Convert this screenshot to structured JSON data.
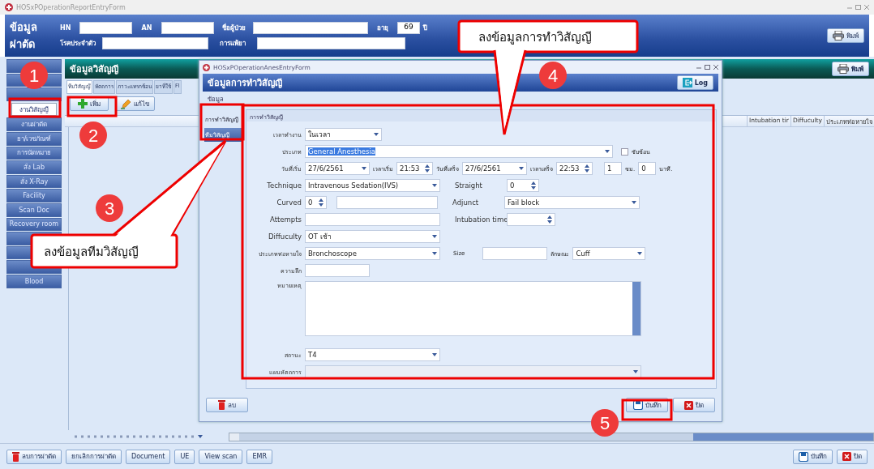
{
  "window": {
    "title": "HOSxPOperationReportEntryForm"
  },
  "patient_header": {
    "title": "ข้อมูลผ่าตัด",
    "fields": [
      {
        "label": "HN"
      },
      {
        "label": "AN"
      },
      {
        "label": "ชื่อผู้ป่วย"
      },
      {
        "label": "อายุ",
        "value": "69",
        "unit": "ปี"
      },
      {
        "label": "โรคประจำตัว"
      },
      {
        "label": "การแพ้ยา"
      }
    ],
    "print_button": {
      "label": "พิมพ์",
      "kind": "print"
    }
  },
  "sidebar": {
    "items": [
      {
        "selected": false
      },
      {
        "selected": false
      },
      {
        "selected": false
      },
      {
        "label": "งานวิสัญญี",
        "selected": true
      },
      {
        "label": "งานผ่าตัด",
        "selected": false
      },
      {
        "label": "ยา/เวชภัณฑ์",
        "selected": false
      },
      {
        "label": "การนัดหมาย",
        "selected": false
      },
      {
        "label": "สั่ง Lab",
        "selected": false
      },
      {
        "label": "สั่ง X-Ray",
        "selected": false
      },
      {
        "label": "Facility",
        "selected": false
      },
      {
        "label": "Scan Doc",
        "selected": false
      },
      {
        "label": "Recovery room",
        "selected": false
      },
      {
        "selected": false
      },
      {
        "selected": false
      },
      {
        "selected": false
      },
      {
        "label": "Blood",
        "selected": false
      }
    ]
  },
  "anes_panel": {
    "title": "ข้อมูลวิสัญญี",
    "print_button": {
      "label": "พิมพ์",
      "kind": "print"
    },
    "tabs": [
      {
        "label": "ทีมวิสัญญี",
        "selected": true
      },
      {
        "label": "หัตถการ",
        "selected": false
      },
      {
        "label": "ภาวะแทรกซ้อน",
        "selected": false
      },
      {
        "label": "ยาที่ใช้",
        "selected": false
      },
      {
        "label": "Fl",
        "selected": false
      }
    ],
    "toolbar": [
      {
        "label": "เพิ่ม",
        "kind": "add"
      },
      {
        "label": "แก้ไข",
        "kind": "edit"
      }
    ],
    "columns": [
      "Intubation tir",
      "Diffuculty",
      "ประเภทท่อหายใจ"
    ]
  },
  "dialog": {
    "title": "HOSxPOperationAnesEntryForm",
    "header": "ข้อมูลการทำวิสัญญี",
    "log_button": {
      "label": "Log",
      "kind": "log"
    },
    "menu": "ข้อมูล",
    "nav": [
      {
        "label": "การทำวิสัญญี",
        "selected": false
      },
      {
        "label": "ทีมวิสัญญี",
        "selected": true
      }
    ],
    "form": {
      "group_title": "การทำวิสัญญี",
      "work_time": {
        "label": "เวลาทำงาน",
        "value": "ในเวลา"
      },
      "type": {
        "label": "ประเภท",
        "value": "General Anesthesia",
        "highlighted": true
      },
      "complex": {
        "label": "ซับซ้อน",
        "checked": false
      },
      "start_date": {
        "label": "วันที่เริ่ม",
        "value": "27/6/2561"
      },
      "start_time": {
        "label": "เวลาเริ่ม",
        "value": "21:53"
      },
      "end_date": {
        "label": "วันที่เสร็จ",
        "value": "27/6/2561"
      },
      "end_time": {
        "label": "เวลาเสร็จ",
        "value": "22:53"
      },
      "hours": {
        "value": "1",
        "unit": "ชม."
      },
      "minutes": {
        "value": "0",
        "unit": "นาที."
      },
      "technique": {
        "label": "Technique",
        "value": "Intravenous Sedation(IVS)"
      },
      "straight": {
        "label": "Straight",
        "value": "0"
      },
      "curved": {
        "label": "Curved",
        "value": "0"
      },
      "adjunct": {
        "label": "Adjunct",
        "value": "Fail block"
      },
      "attempts": {
        "label": "Attempts"
      },
      "intubation_time": {
        "label": "Intubation time"
      },
      "difficulty": {
        "label": "Diffuculty",
        "value": "OT เช้า"
      },
      "tube_type": {
        "label": "ประเภทท่อหายใจ",
        "value": "Bronchoscope"
      },
      "size": {
        "label": "Size"
      },
      "character": {
        "label": "ลักษณะ",
        "value": "Cuff"
      },
      "depth": {
        "label": "ความลึก"
      },
      "note": {
        "label": "หมายเหตุ"
      },
      "status": {
        "label": "สถานะ",
        "value": "T4"
      },
      "plan": {
        "label": "แผนหัตถการ",
        "disabled": true
      }
    },
    "footer_left": [
      {
        "label": "ลบ",
        "kind": "delete"
      }
    ],
    "footer_right": [
      {
        "label": "บันทึก",
        "kind": "save"
      },
      {
        "label": "ปิด",
        "kind": "close"
      }
    ]
  },
  "bottom_bar": {
    "left_buttons": [
      {
        "label": "ลบการผ่าตัด",
        "kind": "delete"
      },
      {
        "label": "ยกเลิกการผ่าตัด",
        "kind": "plain"
      },
      {
        "label": "Document",
        "kind": "plain"
      },
      {
        "label": "UE",
        "kind": "plain"
      },
      {
        "label": "View scan",
        "kind": "plain"
      },
      {
        "label": "EMR",
        "kind": "plain"
      }
    ],
    "right_buttons": [
      {
        "label": "บันทึก",
        "kind": "save"
      },
      {
        "label": "ปิด",
        "kind": "close"
      }
    ]
  },
  "callouts": {
    "numbers": [
      "1",
      "2",
      "3",
      "4",
      "5"
    ],
    "bubbles": [
      "ลงข้อมูลการทำวิสัญญี",
      "ลงข้อมูลทีมวิสัญญี"
    ]
  }
}
